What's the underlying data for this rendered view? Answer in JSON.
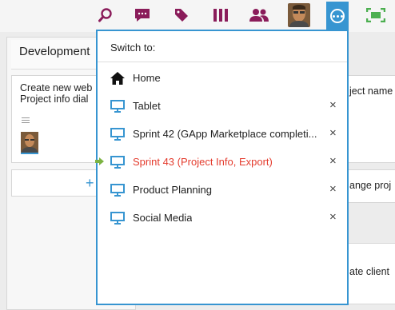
{
  "toolbar": {
    "icons": [
      "search-icon",
      "chat-icon",
      "tag-icon",
      "columns-icon",
      "people-icon",
      "avatar",
      "more-icon",
      "fullscreen-icon"
    ],
    "accent": "#8a1c5a",
    "active_bg": "#3795d1"
  },
  "board": {
    "column_title": "Development",
    "card_title_line1": "Create new web",
    "card_title_line2": "Project info dial",
    "right_cards": [
      "ject name",
      "ange proj",
      "ate client"
    ]
  },
  "switcher": {
    "header": "Switch to:",
    "items": [
      {
        "label": "Home",
        "icon": "home-icon",
        "close": "",
        "current": false
      },
      {
        "label": "Tablet",
        "icon": "board-icon",
        "close": "×",
        "current": false
      },
      {
        "label": "Sprint 42 (GApp Marketplace completi...",
        "icon": "board-icon",
        "close": "×",
        "current": false
      },
      {
        "label": "Sprint 43 (Project Info, Export)",
        "icon": "board-icon",
        "close": "×",
        "current": true
      },
      {
        "label": "Product Planning",
        "icon": "board-icon",
        "close": "×",
        "current": false
      },
      {
        "label": "Social Media",
        "icon": "board-icon",
        "close": "×",
        "current": false
      }
    ],
    "current_color": "#e43c2e"
  }
}
